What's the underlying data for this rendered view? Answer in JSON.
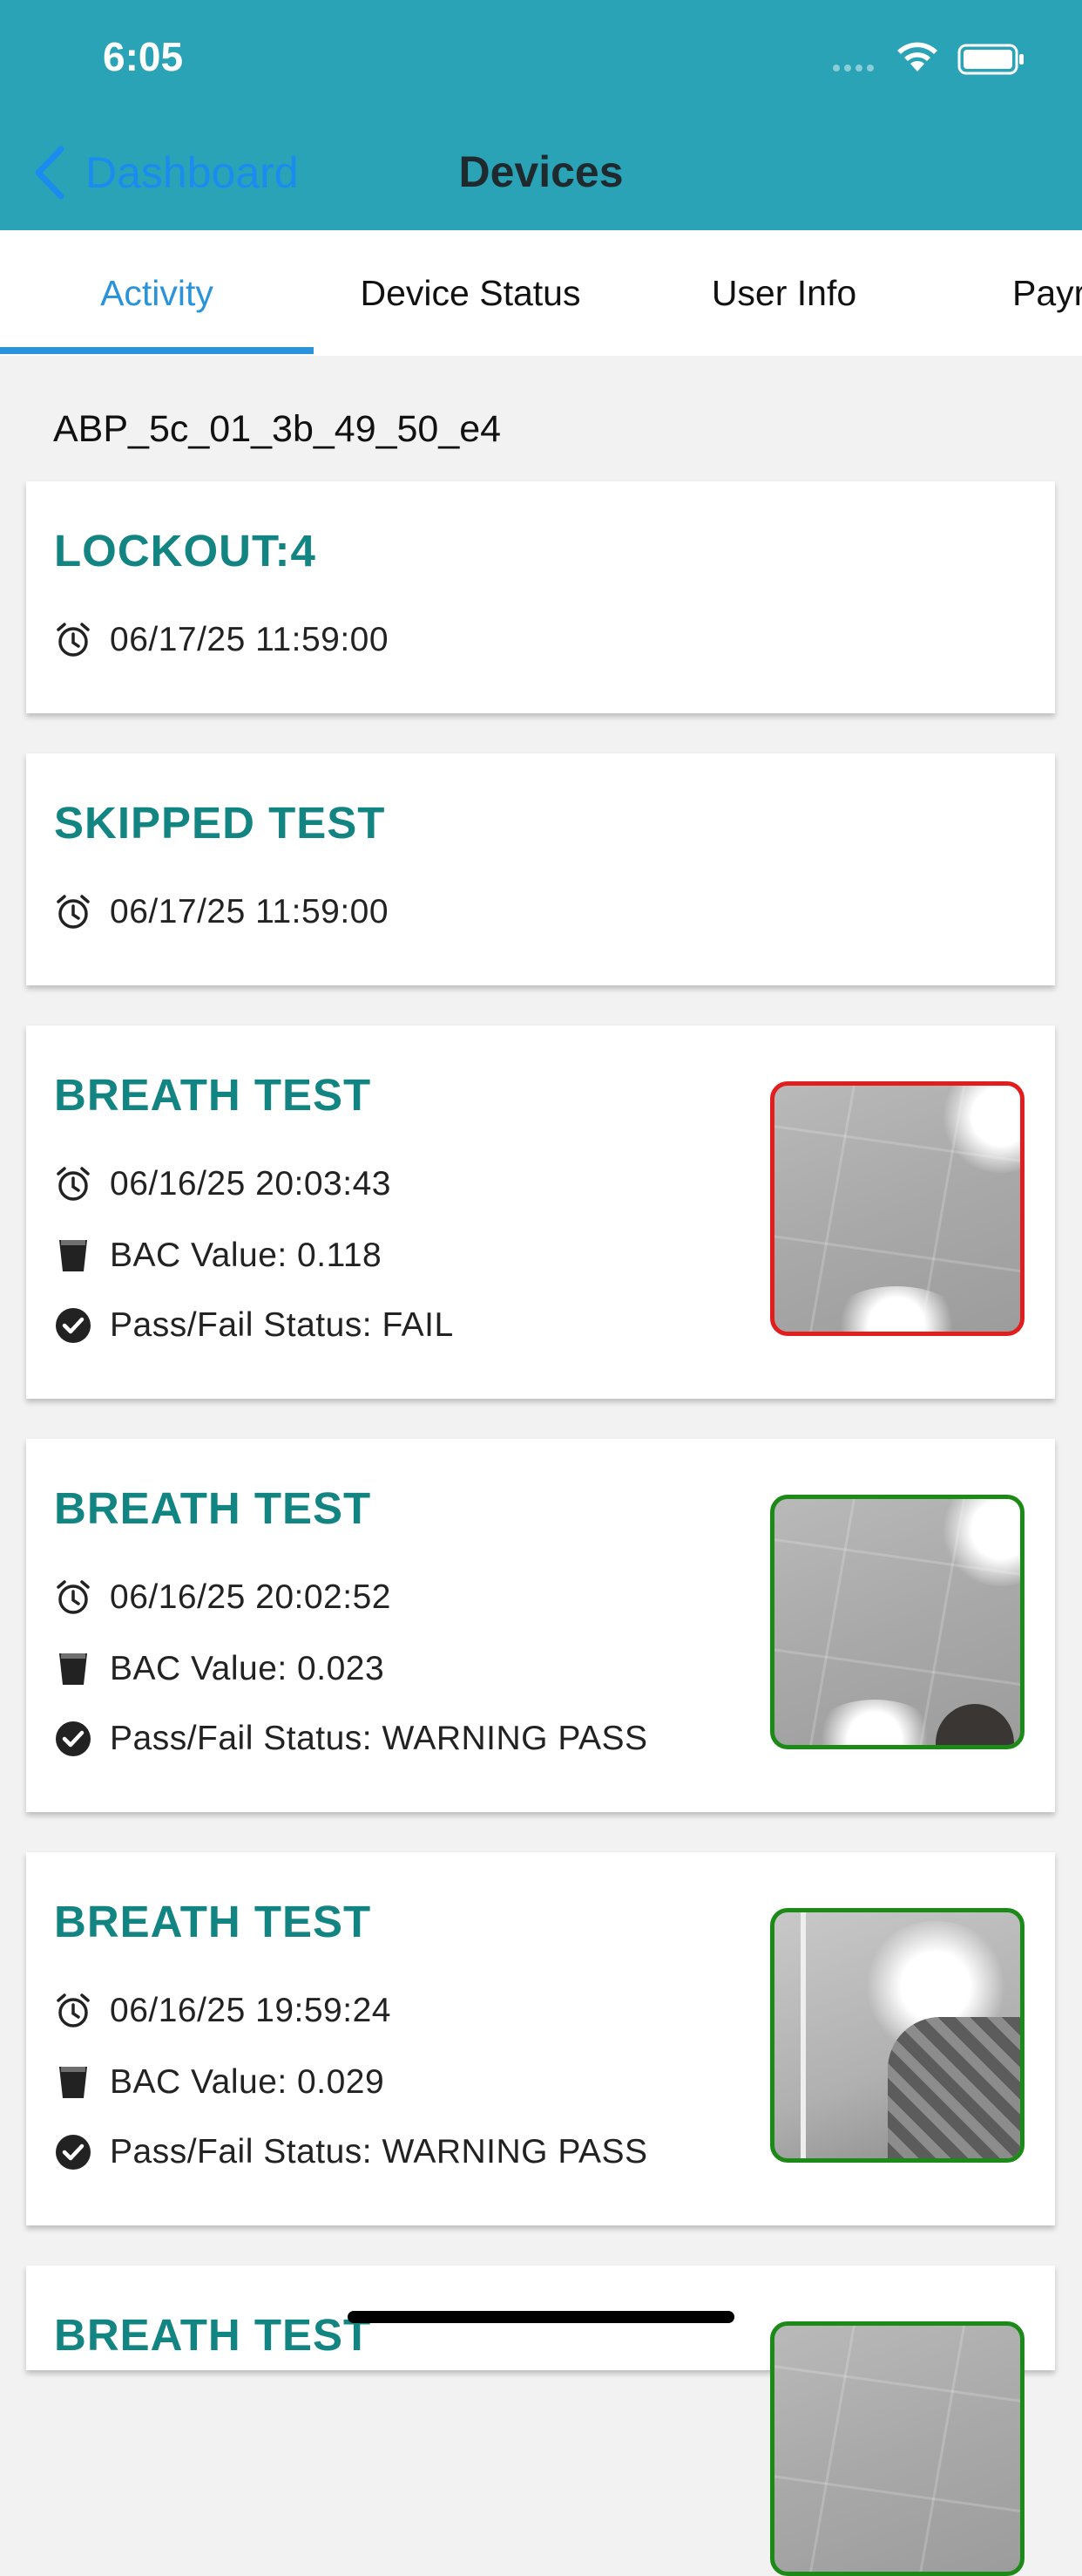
{
  "status_bar": {
    "time": "6:05"
  },
  "nav": {
    "back_label": "Dashboard",
    "title": "Devices"
  },
  "tabs": [
    {
      "label": "Activity",
      "active": true
    },
    {
      "label": "Device Status"
    },
    {
      "label": "User Info"
    },
    {
      "label": "Payr"
    }
  ],
  "device_id": "ABP_5c_01_3b_49_50_e4",
  "colors": {
    "header": "#2aa3b6",
    "accent": "#2a93d9",
    "title": "#128583",
    "fail": "#e21d1d",
    "pass": "#1c8a16"
  },
  "icons": {
    "time": "alarm-clock-icon",
    "bac": "cup-icon",
    "status": "check-circle-icon"
  },
  "events": [
    {
      "title": "LOCKOUT:4",
      "time": "06/17/25 11:59:00"
    },
    {
      "title": "SKIPPED TEST",
      "time": "06/17/25 11:59:00"
    },
    {
      "title": "BREATH TEST",
      "time": "06/16/25 20:03:43",
      "bac": "BAC Value: 0.118",
      "status": "Pass/Fail Status: FAIL",
      "result": "fail"
    },
    {
      "title": "BREATH TEST",
      "time": "06/16/25 20:02:52",
      "bac": "BAC Value: 0.023",
      "status": "Pass/Fail Status: WARNING PASS",
      "result": "pass"
    },
    {
      "title": "BREATH TEST",
      "time": "06/16/25 19:59:24",
      "bac": "BAC Value: 0.029",
      "status": "Pass/Fail Status: WARNING PASS",
      "result": "pass"
    },
    {
      "title": "BREATH TEST"
    }
  ]
}
